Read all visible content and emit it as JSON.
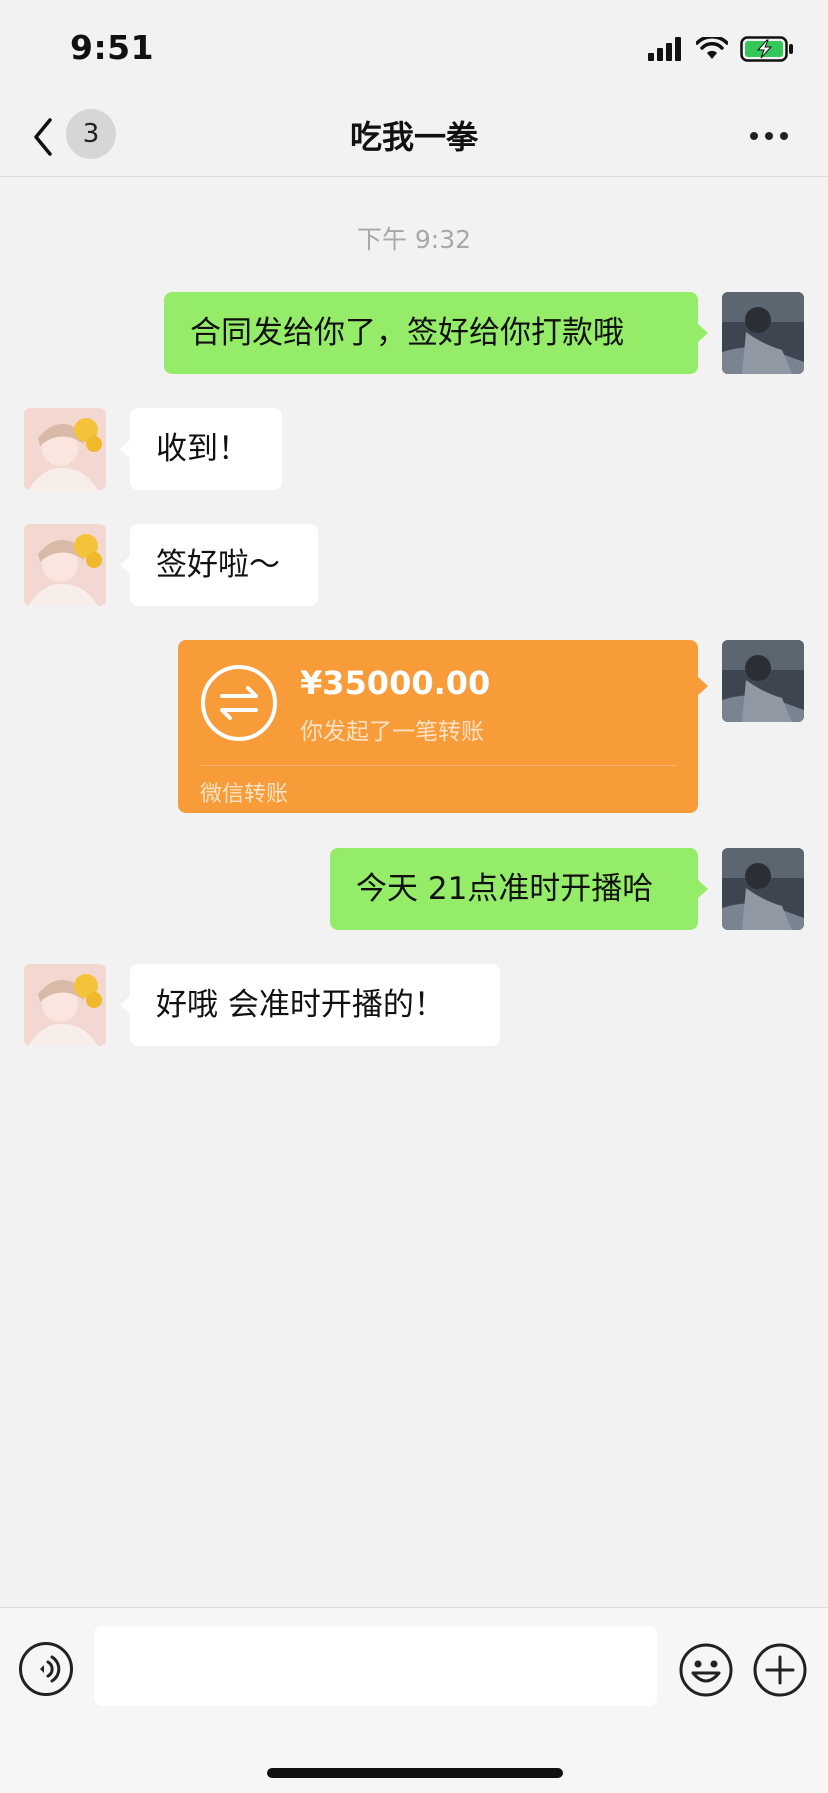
{
  "status_bar": {
    "time": "9:51",
    "icons": [
      "signal-icon",
      "wifi-icon",
      "battery-charging-icon"
    ]
  },
  "nav": {
    "back_icon": "chevron-left-icon",
    "unread_count": "3",
    "title": "吃我一拳",
    "more_icon": "more-icon"
  },
  "chat": {
    "timestamp": "下午 9:32",
    "messages": [
      {
        "side": "out",
        "text": "合同发给你了，签好给你打款哦"
      },
      {
        "side": "in",
        "text": "收到！"
      },
      {
        "side": "in",
        "text": "签好啦～"
      },
      {
        "side": "out",
        "type": "transfer",
        "amount": "¥35000.00",
        "description": "你发起了一笔转账",
        "label": "微信转账"
      },
      {
        "side": "out",
        "text": "今天 21点准时开播哈"
      },
      {
        "side": "in",
        "text": "好哦 会准时开播的！"
      }
    ]
  },
  "input_bar": {
    "voice_icon": "voice-icon",
    "text_value": "",
    "emoji_icon": "emoji-icon",
    "plus_icon": "plus-icon"
  },
  "colors": {
    "outgoing_bubble": "#95ec69",
    "incoming_bubble": "#ffffff",
    "transfer_card": "#f89c3a",
    "background": "#f2f2f2"
  }
}
